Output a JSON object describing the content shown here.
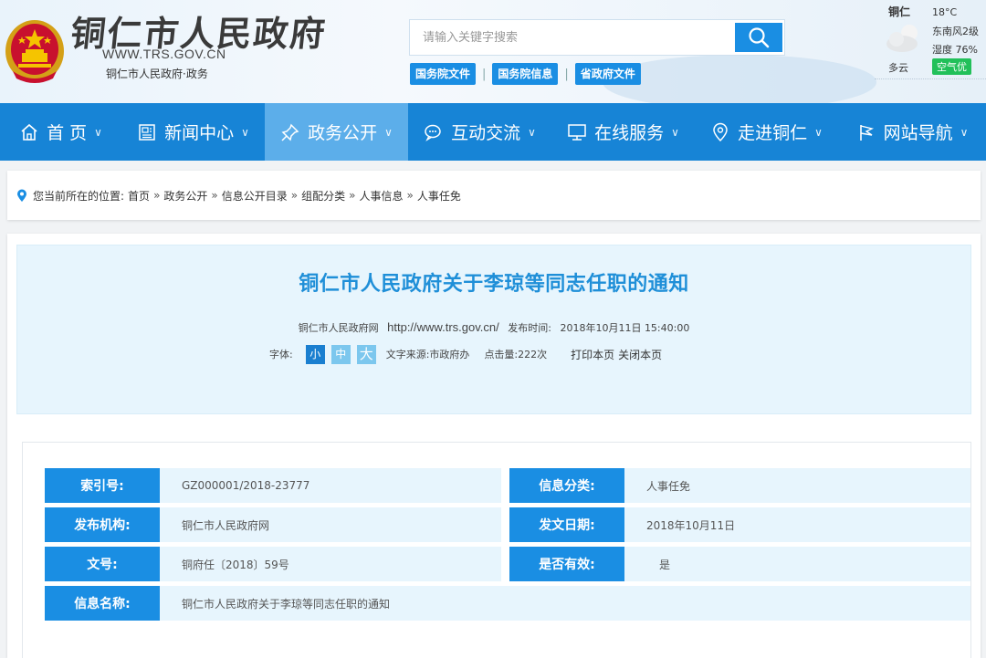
{
  "header": {
    "site_title": "铜仁市人民政府",
    "site_url": "WWW.TRS.GOV.CN",
    "site_sub": "铜仁市人民政府·政务",
    "search_placeholder": "请输入关键字搜索",
    "quick_links": [
      "国务院文件",
      "国务院信息",
      "省政府文件"
    ],
    "weather": {
      "city": "铜仁",
      "temp": "18°C",
      "wind": "东南风2级",
      "humidity": "湿度 76%",
      "condition": "多云",
      "air": "空气优"
    }
  },
  "nav": {
    "items": [
      {
        "label": "首 页",
        "icon": "home-icon"
      },
      {
        "label": "新闻中心",
        "icon": "newspaper-icon"
      },
      {
        "label": "政务公开",
        "icon": "thumbtack-icon"
      },
      {
        "label": "互动交流",
        "icon": "chat-icon"
      },
      {
        "label": "在线服务",
        "icon": "monitor-icon"
      },
      {
        "label": "走进铜仁",
        "icon": "location-icon"
      },
      {
        "label": "网站导航",
        "icon": "flag-icon"
      }
    ],
    "active_index": 2
  },
  "breadcrumb": {
    "prefix": "您当前所在的位置:",
    "items": [
      "首页",
      "政务公开",
      "信息公开目录",
      "组配分类",
      "人事信息",
      "人事任免"
    ]
  },
  "article": {
    "title": "铜仁市人民政府关于李琼等同志任职的通知",
    "source_site": "铜仁市人民政府网",
    "source_url": "http://www.trs.gov.cn/",
    "publish_label": "发布时间:",
    "publish_time": "2018年10月11日 15:40:00",
    "font_label": "字体:",
    "font_sizes": [
      "小",
      "中",
      "大"
    ],
    "text_source": "文字来源:市政府办",
    "hits": "点击量:222次",
    "print": "打印本页",
    "close": "关闭本页"
  },
  "info": {
    "index_label": "索引号:",
    "index_value": "GZ000001/2018-23777",
    "category_label": "信息分类:",
    "category_value": "人事任免",
    "publisher_label": "发布机构:",
    "publisher_value": "铜仁市人民政府网",
    "date_label": "发文日期:",
    "date_value": "2018年10月11日",
    "doc_no_label": "文号:",
    "doc_no_value": "铜府任〔2018〕59号",
    "valid_label": "是否有效:",
    "valid_value": "是",
    "name_label": "信息名称:",
    "name_value": "铜仁市人民政府关于李琼等同志任职的通知"
  },
  "colors": {
    "nav_bg": "#1784d6",
    "nav_active": "#5caeea",
    "accent": "#1a8ee3",
    "title": "#1f8fd8",
    "panel_tint": "#e7f5fd",
    "air_badge": "#22c05a"
  }
}
